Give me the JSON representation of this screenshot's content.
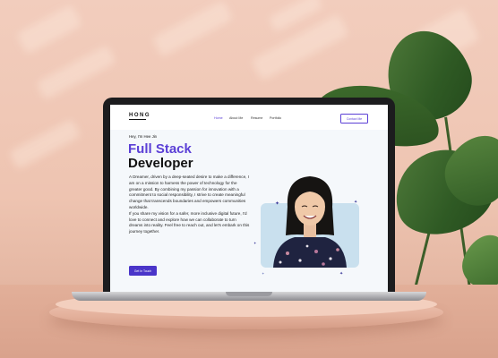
{
  "website": {
    "logo": "HONG",
    "nav": {
      "items": [
        {
          "label": "Home",
          "active": true
        },
        {
          "label": "About Me",
          "active": false
        },
        {
          "label": "Resume",
          "active": false
        },
        {
          "label": "Portfolio",
          "active": false
        }
      ],
      "contact_button": "Contact Me"
    },
    "hero": {
      "greeting": "Hey, I'm Hee Jin",
      "title_line1": "Full Stack",
      "title_line2": "Developer",
      "paragraph1": "A Dreamer, driven by a deep-seated desire to make a difference, I am on a mission to harness the power of technology for the greater good. By combining my passion for innovation with a commitment to social responsibility, I strive to create meaningful change that transcends boundaries and empowers communities worldwide.",
      "paragraph2": "If you share my vision for a safer, more inclusive digital future, I'd love to connect and explore how we can collaborate to turn dreams into reality. Feel free to reach out, and let's embark on this journey together.",
      "cta_button": "Get In Touch"
    }
  },
  "colors": {
    "accent": "#5b3fd6",
    "button": "#4a35c9",
    "hero_bg": "#f5f8fb",
    "photo_bg": "#c9e0ee",
    "wall": "#f0c8b6"
  },
  "icons": [
    "sparkle-icon",
    "plant-decoration",
    "laptop-frame"
  ]
}
